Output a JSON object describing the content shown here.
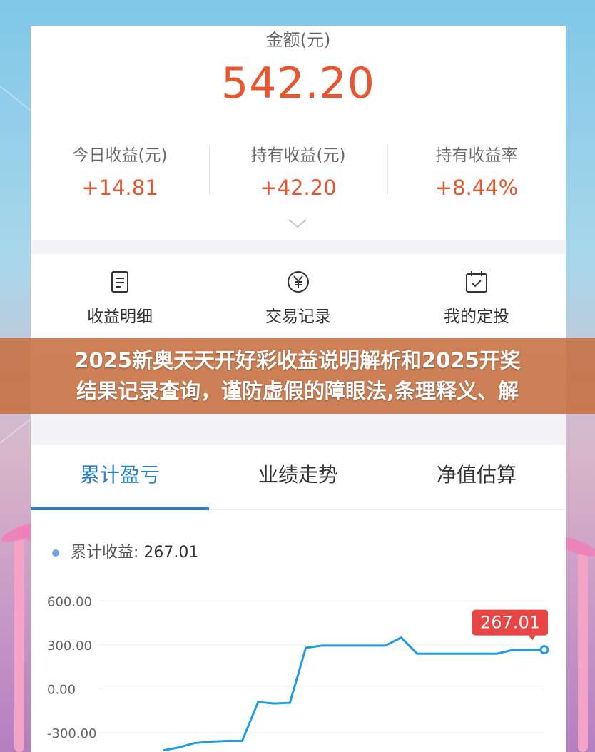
{
  "summary": {
    "amount_label": "金额(元)",
    "amount_value": "542.20",
    "stats": [
      {
        "label": "今日收益(元)",
        "value": "+14.81"
      },
      {
        "label": "持有收益(元)",
        "value": "+42.20"
      },
      {
        "label": "持有收益率",
        "value": "+8.44%"
      }
    ]
  },
  "actions": [
    {
      "label": "收益明细",
      "icon": "document-icon"
    },
    {
      "label": "交易记录",
      "icon": "yuan-coin-icon"
    },
    {
      "label": "我的定投",
      "icon": "calendar-check-icon"
    }
  ],
  "banner": {
    "line1": "2025新奥天天开好彩收益说明解析和2025开奖",
    "line2": "结果记录查询，谨防虚假的障眼法,条理释义、解"
  },
  "tabs": [
    {
      "label": "累计盈亏",
      "active": true
    },
    {
      "label": "业绩走势",
      "active": false
    },
    {
      "label": "净值估算",
      "active": false
    }
  ],
  "legend": {
    "label": "累计收益:",
    "value": "267.01"
  },
  "colors": {
    "accent_red": "#e8552e",
    "accent_blue": "#2a7fd4",
    "line_blue": "#1f9be8",
    "tooltip_red": "#e84545"
  },
  "chart_data": {
    "type": "line",
    "series": [
      {
        "name": "累计收益",
        "values": [
          -420,
          -400,
          -370,
          -360,
          -355,
          -355,
          -90,
          -100,
          -95,
          280,
          295,
          295,
          295,
          295,
          295,
          350,
          240,
          240,
          240,
          240,
          240,
          240,
          265,
          265,
          267.01
        ]
      }
    ],
    "yticks": [
      "600.00",
      "300.00",
      "0.00",
      "-300.00"
    ],
    "ylim": [
      -450,
      650
    ],
    "callout": "267.01",
    "grid": true
  }
}
